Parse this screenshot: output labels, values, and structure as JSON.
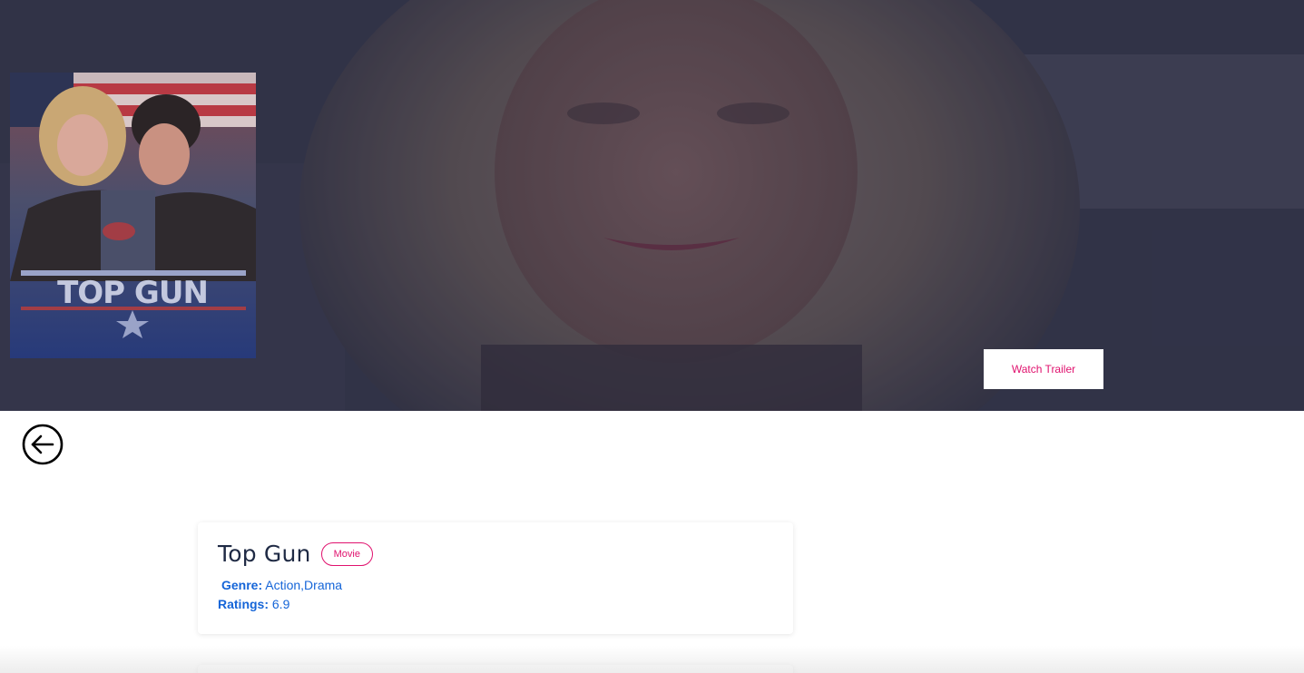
{
  "hero": {
    "backdrop_name": "movie-backdrop",
    "poster_text": "TOP GUN"
  },
  "trailer_button": {
    "label": "Watch Trailer",
    "color": "#e0126e"
  },
  "back_button": {
    "icon": "arrow-left-circle-icon"
  },
  "details": {
    "title": "Top Gun",
    "type_badge": "Movie",
    "genre_label": "Genre:",
    "genre_value": "Action,Drama",
    "ratings_label": "Ratings:",
    "ratings_value": "6.9"
  },
  "colors": {
    "accent": "#e0126e",
    "link_blue": "#1565d8",
    "title_text": "#1f2a44"
  }
}
